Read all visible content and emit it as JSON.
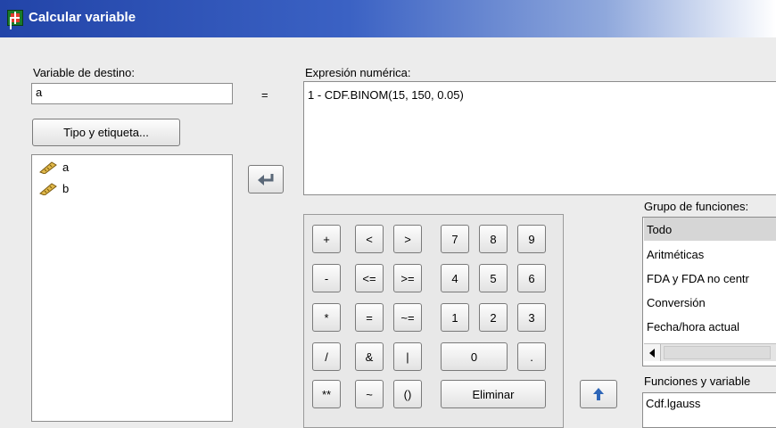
{
  "window": {
    "title": "Calcular variable"
  },
  "target": {
    "label": "Variable de destino:",
    "value": "a"
  },
  "equals_sign": "=",
  "type_label_button": "Tipo y etiqueta...",
  "variables": [
    {
      "name": "a",
      "icon": "ruler-icon"
    },
    {
      "name": "b",
      "icon": "ruler-icon"
    }
  ],
  "expression": {
    "label": "Expresión numérica:",
    "value": "1 - CDF.BINOM(15, 150, 0.05)"
  },
  "keypad": {
    "operators": [
      [
        "+",
        "<",
        ">"
      ],
      [
        "-",
        "<=",
        ">="
      ],
      [
        "*",
        "=",
        "~="
      ],
      [
        "/",
        "&",
        "|"
      ],
      [
        "**",
        "~",
        "()"
      ]
    ],
    "digits": [
      [
        "7",
        "8",
        "9"
      ],
      [
        "4",
        "5",
        "6"
      ],
      [
        "1",
        "2",
        "3"
      ]
    ],
    "zero": "0",
    "dot": ".",
    "delete": "Eliminar"
  },
  "function_group": {
    "label": "Grupo de funciones:",
    "items": [
      "Todo",
      "Aritméticas",
      "FDA y FDA no centr",
      "Conversión",
      "Fecha/hora actual"
    ],
    "selected_index": 0
  },
  "functions": {
    "label": "Funciones y variable",
    "first_item": "Cdf.lgauss"
  },
  "colors": {
    "title_start": "#2244a8",
    "selected_bg": "#d6d6d6"
  }
}
